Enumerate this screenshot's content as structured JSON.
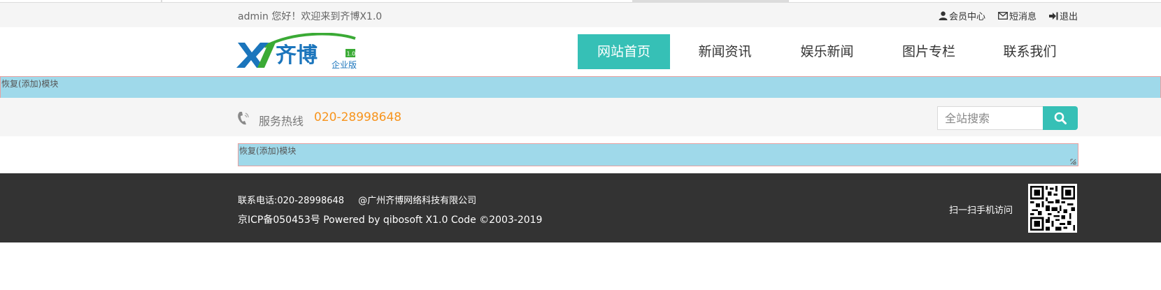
{
  "topbar": {
    "welcome": "admin 您好！欢迎来到齐博X1.0",
    "links": [
      {
        "label": "会员中心",
        "icon": "user-icon"
      },
      {
        "label": "短消息",
        "icon": "mail-icon"
      },
      {
        "label": "退出",
        "icon": "logout-icon"
      }
    ]
  },
  "logo": {
    "text": "齐博",
    "version": "1.0",
    "edition": "企业版"
  },
  "nav": [
    {
      "label": "网站首页",
      "active": true
    },
    {
      "label": "新闻资讯",
      "active": false
    },
    {
      "label": "娱乐新闻",
      "active": false
    },
    {
      "label": "图片专栏",
      "active": false
    },
    {
      "label": "联系我们",
      "active": false
    }
  ],
  "modules": {
    "top_label": "恢复(添加)模块",
    "content_label": "恢复(添加)模块"
  },
  "service": {
    "label": "服务热线",
    "phone": "020-28998648",
    "icon": "phone-icon"
  },
  "search": {
    "placeholder": "全站搜索",
    "icon": "search-icon"
  },
  "footer": {
    "contact": "联系电话:020-28998648",
    "company": "@广州齐博网络科技有限公司",
    "copyright": "京ICP备050453号 Powered by qibosoft X1.0 Code ©2003-2019",
    "scan_text": "扫一扫手机访问"
  },
  "colors": {
    "accent": "#36c0b6",
    "phone": "#f7941d",
    "module_bg": "#9fd9ea",
    "footer_bg": "#333333",
    "logo_blue": "#1b75bc",
    "logo_green": "#3aaa35"
  }
}
